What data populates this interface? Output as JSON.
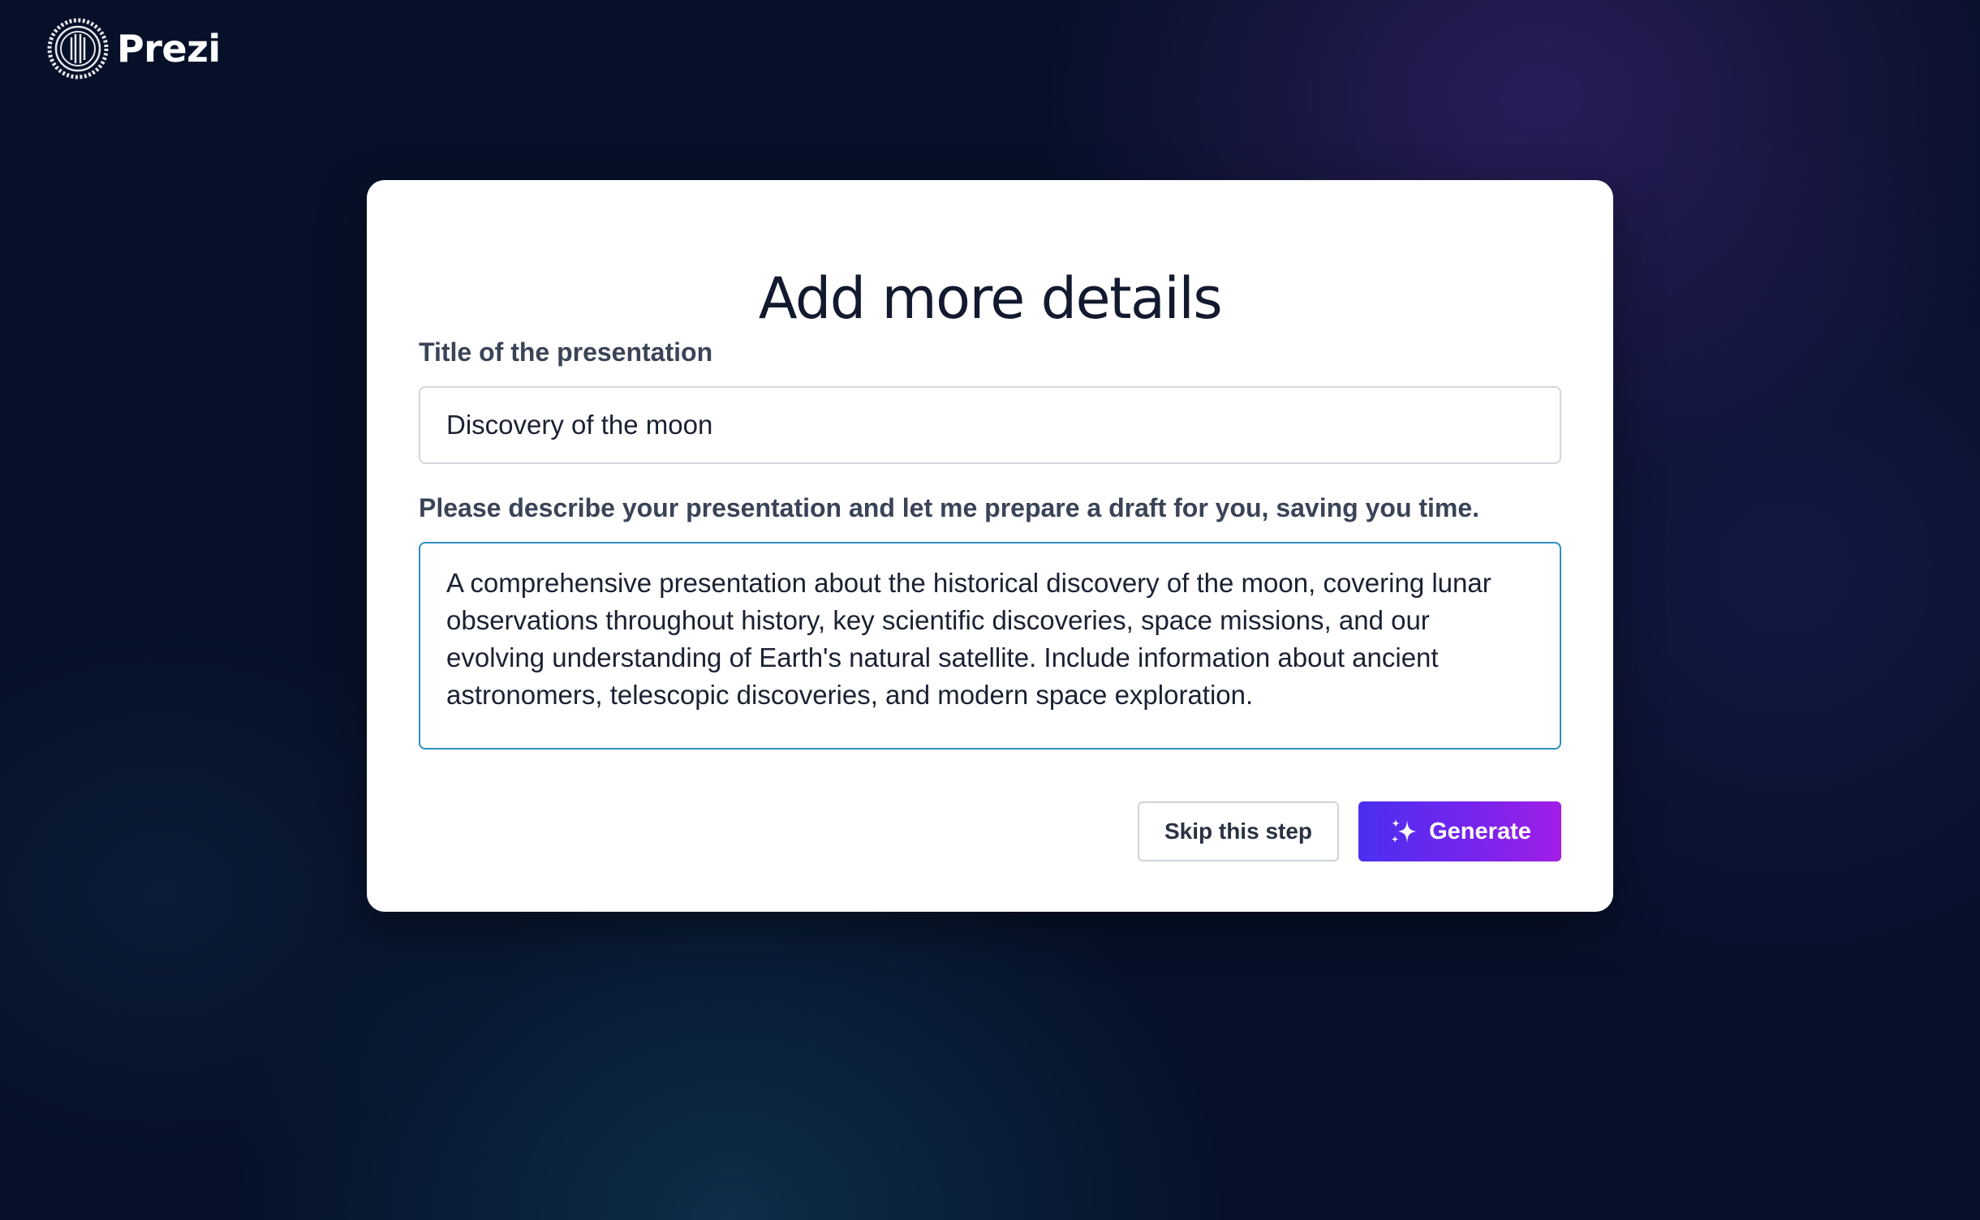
{
  "brand": {
    "name": "Prezi",
    "icon": "prezi-logo-icon"
  },
  "dialog": {
    "title": "Add more details",
    "title_label": "Title of the presentation",
    "title_value": "Discovery of the moon",
    "description_label": "Please describe your presentation and let me prepare a draft for you, saving you time.",
    "description_value": "A comprehensive presentation about the historical discovery of the moon, covering lunar observations throughout history, key scientific discoveries, space missions, and our evolving understanding of Earth's natural satellite. Include information about ancient astronomers, telescopic discoveries, and modern space exploration.",
    "skip_label": "Skip this step",
    "generate_label": "Generate",
    "generate_icon": "sparkle-icon"
  },
  "colors": {
    "background": "#061028",
    "card": "#ffffff",
    "accent_start": "#4a2ff0",
    "accent_end": "#a21ee6",
    "focus_border": "#2d8fc0"
  }
}
